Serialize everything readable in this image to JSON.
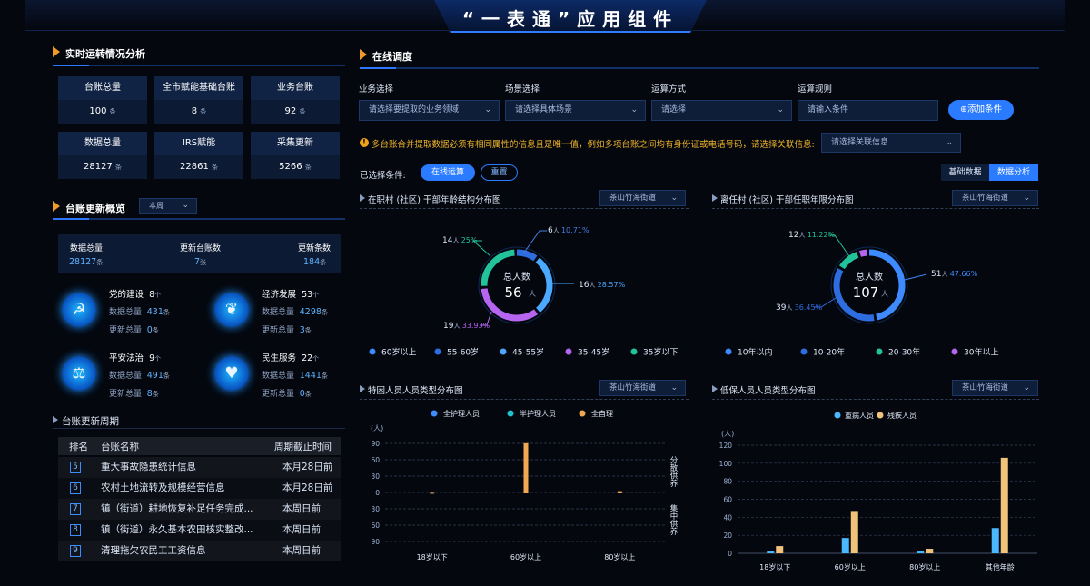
{
  "app": {
    "title": "“一表通”应用组件"
  },
  "realtime": {
    "title": "实时运转情况分析",
    "stats": [
      {
        "label": "台账总量",
        "value": "100",
        "unit": "条"
      },
      {
        "label": "全市赋能基础台账",
        "value": "8",
        "unit": "条"
      },
      {
        "label": "业务台账",
        "value": "92",
        "unit": "条"
      },
      {
        "label": "数据总量",
        "value": "28127",
        "unit": "条"
      },
      {
        "label": "IRS赋能",
        "value": "22861",
        "unit": "条"
      },
      {
        "label": "采集更新",
        "value": "5266",
        "unit": "条"
      }
    ]
  },
  "update_overview": {
    "title": "台账更新概览",
    "period": "本周",
    "summary": [
      {
        "label": "数据总量",
        "value": "28127",
        "unit": "条"
      },
      {
        "label": "更新台账数",
        "value": "7",
        "unit": "张"
      },
      {
        "label": "更新条数",
        "value": "184",
        "unit": "条"
      }
    ],
    "sub_labels": {
      "total": "数据总量",
      "updated": "更新总量"
    },
    "categories": [
      {
        "name": "党的建设",
        "count": "8",
        "count_unit": "个",
        "total": "431",
        "updated": "0",
        "unit": "条",
        "icon": "party-icon"
      },
      {
        "name": "经济发展",
        "count": "53",
        "count_unit": "个",
        "total": "4298",
        "updated": "3",
        "unit": "条",
        "icon": "leaf-icon"
      },
      {
        "name": "平安法治",
        "count": "9",
        "count_unit": "个",
        "total": "491",
        "updated": "8",
        "unit": "条",
        "icon": "gavel-icon"
      },
      {
        "name": "民生服务",
        "count": "22",
        "count_unit": "个",
        "total": "1441",
        "updated": "0",
        "unit": "条",
        "icon": "heart-icon"
      }
    ]
  },
  "cycle": {
    "title": "台账更新周期",
    "headers": [
      "排名",
      "台账名称",
      "周期截止时间"
    ],
    "rows": [
      {
        "rank": "5",
        "name": "重大事故隐患统计信息",
        "date": "本月28日前"
      },
      {
        "rank": "6",
        "name": "农村土地流转及规模经营信息",
        "date": "本月28日前"
      },
      {
        "rank": "7",
        "name": "镇（街道）耕地恢复补足任务完成...",
        "date": "本周日前"
      },
      {
        "rank": "8",
        "name": "镇（街道）永久基本农田核实整改...",
        "date": "本周日前"
      },
      {
        "rank": "9",
        "name": "清理拖欠农民工工资信息",
        "date": "本周日前"
      }
    ]
  },
  "dispatch": {
    "title": "在线调度",
    "filters": [
      {
        "label": "业务选择",
        "placeholder": "请选择要提取的业务领域"
      },
      {
        "label": "场景选择",
        "placeholder": "请选择具体场景"
      },
      {
        "label": "运算方式",
        "placeholder": "请选择"
      },
      {
        "label": "运算规则",
        "placeholder": "请输入条件"
      }
    ],
    "add_button": "⊕添加条件",
    "notice": "多台账合并提取数据必须有相同属性的信息且是唯一值，例如多项台账之间均有身份证或电话号码，请选择关联信息:",
    "related_placeholder": "请选择关联信息",
    "selected_label": "已选择条件:",
    "tag_online": "在线运算",
    "tag_reset": "重置",
    "tabs": [
      "基础数据",
      "数据分析"
    ]
  },
  "chart1": {
    "title": "在职村 (社区) 干部年龄结构分布图",
    "street": "茶山竹海街道",
    "center_label": "总人数",
    "total": "56",
    "unit": "人",
    "labels": [
      {
        "n": "6",
        "pct": "10.71%"
      },
      {
        "n": "16",
        "pct": "28.57%"
      },
      {
        "n": "19",
        "pct": "33.93%"
      },
      {
        "n": "14",
        "pct": "25%"
      }
    ],
    "legend": [
      "60岁以上",
      "55-60岁",
      "45-55岁",
      "35-45岁",
      "35岁以下"
    ]
  },
  "chart2": {
    "title": "离任村 (社区) 干部任职年限分布图",
    "street": "茶山竹海街道",
    "center_label": "总人数",
    "total": "107",
    "unit": "人",
    "labels": [
      {
        "n": "51",
        "pct": "47.66%"
      },
      {
        "n": "39",
        "pct": "36.45%"
      },
      {
        "n": "12",
        "pct": "11.22%"
      }
    ],
    "legend": [
      "10年以内",
      "10-20年",
      "20-30年",
      "30年以上"
    ]
  },
  "chart3": {
    "title": "特困人员人员类型分布图",
    "street": "茶山竹海街道",
    "unit": "(人)",
    "side_top": "分散供养",
    "side_bottom": "集中供养",
    "legend": [
      "全护理人员",
      "半护理人员",
      "全自理"
    ],
    "yticks": [
      "90",
      "60",
      "30",
      "0",
      "30",
      "60",
      "90"
    ],
    "categories": [
      "18岁以下",
      "60岁以上",
      "80岁以上"
    ]
  },
  "chart4": {
    "title": "低保人员人员类型分布图",
    "street": "茶山竹海街道",
    "unit": "(人)",
    "legend": [
      "重病人员",
      "残疾人员"
    ],
    "yticks": [
      "120",
      "100",
      "80",
      "60",
      "40",
      "20",
      "0"
    ],
    "categories": [
      "18岁以下",
      "60岁以上",
      "80岁以上",
      "其他年龄"
    ]
  },
  "chart_data": [
    {
      "type": "pie",
      "title": "在职村 (社区) 干部年龄结构分布图",
      "total": 56,
      "categories": [
        "60岁以上",
        "55-60岁",
        "45-55岁",
        "35-45岁",
        "35岁以下"
      ],
      "values": [
        0,
        6,
        16,
        19,
        14
      ],
      "colors": [
        "#3d8bff",
        "#2e6de0",
        "#4aa8ff",
        "#b565f0",
        "#22c29b"
      ]
    },
    {
      "type": "pie",
      "title": "离任村 (社区) 干部任职年限分布图",
      "total": 107,
      "categories": [
        "10年以内",
        "10-20年",
        "20-30年",
        "30年以上"
      ],
      "values": [
        51,
        39,
        12,
        5
      ],
      "colors": [
        "#3d8bff",
        "#2e6de0",
        "#22c29b",
        "#b565f0"
      ]
    },
    {
      "type": "bar",
      "title": "特困人员人员类型分布图",
      "categories": [
        "18岁以下",
        "60岁以上",
        "80岁以上"
      ],
      "ylim": [
        -90,
        90
      ],
      "series": [
        {
          "name": "全护理人员",
          "values": [
            0,
            0,
            0
          ]
        },
        {
          "name": "半护理人员",
          "values": [
            0,
            0,
            0
          ]
        },
        {
          "name": "全自理",
          "values": [
            1,
            92,
            4
          ]
        }
      ]
    },
    {
      "type": "bar",
      "title": "低保人员人员类型分布图",
      "categories": [
        "18岁以下",
        "60岁以上",
        "80岁以上",
        "其他年龄"
      ],
      "ylim": [
        0,
        120
      ],
      "series": [
        {
          "name": "重病人员",
          "values": [
            2,
            17,
            2,
            28
          ]
        },
        {
          "name": "残疾人员",
          "values": [
            8,
            47,
            5,
            106
          ]
        }
      ]
    }
  ],
  "colors": {
    "accent": "#2a7bff",
    "orange": "#f09a2a",
    "bg": "#04070e"
  }
}
